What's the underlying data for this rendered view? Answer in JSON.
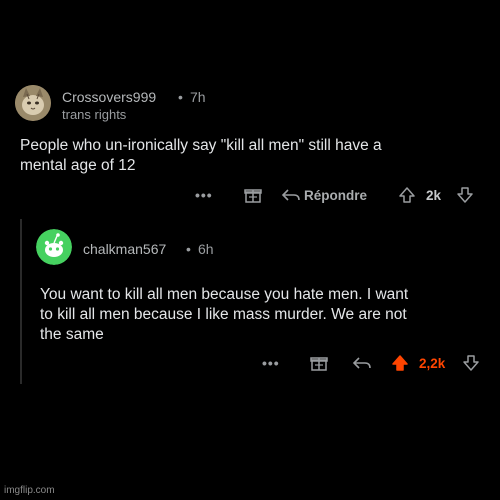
{
  "comments": [
    {
      "username": "Crossovers999",
      "separator": "•",
      "time": "7h",
      "flair": "trans rights",
      "avatar": "cat-avatar",
      "body_lines": [
        "People who un-ironically say \"kill all men\" still have a",
        "mental age of 12"
      ],
      "actions": {
        "more": "•••",
        "award_icon": "gift-icon",
        "reply_icon": "reply-arrow-icon",
        "reply_label": "Répondre",
        "upvote_icon": "upvote-arrow-icon",
        "score": "2k",
        "downvote_icon": "downvote-arrow-icon",
        "upvoted": false
      }
    },
    {
      "username": "chalkman567",
      "separator": "•",
      "time": "6h",
      "avatar": "snoo-avatar",
      "body_lines": [
        "You want to kill all men because you hate men. I want",
        "to kill all men because I like mass murder. We are not",
        "the same"
      ],
      "actions": {
        "more": "•••",
        "award_icon": "gift-icon",
        "reply_icon": "reply-arrow-icon",
        "upvote_icon": "upvote-arrow-icon",
        "score": "2,2k",
        "downvote_icon": "downvote-arrow-icon",
        "upvoted": true
      }
    }
  ],
  "colors": {
    "background": "#000000",
    "text": "#e4e6e8",
    "muted": "#9a9da0",
    "upvote_active": "#ff4500",
    "avatar_green": "#46d160"
  },
  "watermark": "imgflip.com"
}
